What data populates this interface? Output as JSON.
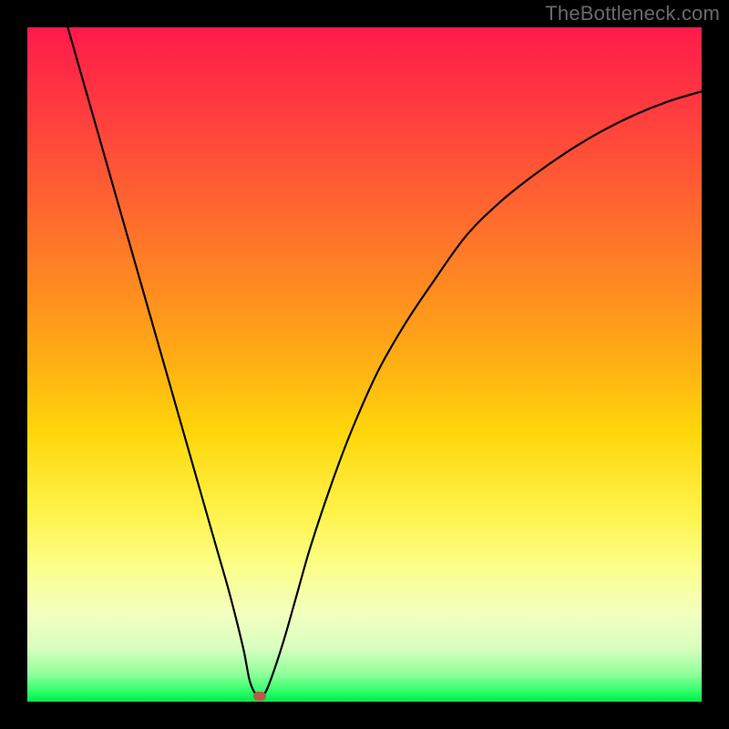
{
  "watermark": "TheBottleneck.com",
  "chart_data": {
    "type": "line",
    "title": "",
    "xlabel": "",
    "ylabel": "",
    "xlim": [
      0,
      100
    ],
    "ylim": [
      0,
      100
    ],
    "series": [
      {
        "name": "bottleneck-curve",
        "x": [
          6,
          8,
          10,
          12,
          14,
          16,
          18,
          20,
          22,
          24,
          26,
          28,
          30,
          32,
          33,
          34,
          35,
          36,
          38,
          40,
          42,
          45,
          48,
          52,
          56,
          60,
          65,
          70,
          75,
          80,
          85,
          90,
          95,
          100
        ],
        "y": [
          100,
          93,
          86,
          79,
          72,
          65,
          58,
          51,
          44,
          37,
          30,
          23,
          16,
          8,
          3,
          1,
          1,
          3,
          9,
          16,
          23,
          32,
          40,
          49,
          56,
          62,
          69,
          74,
          78,
          81.5,
          84.5,
          87,
          89,
          90.5
        ]
      }
    ],
    "marker": {
      "x": 34.5,
      "y": 0.8
    },
    "gradient_stops": [
      {
        "pct": 0,
        "color": "#ff1a4b"
      },
      {
        "pct": 50,
        "color": "#ffb014"
      },
      {
        "pct": 80,
        "color": "#fbff8a"
      },
      {
        "pct": 100,
        "color": "#00e84e"
      }
    ]
  }
}
